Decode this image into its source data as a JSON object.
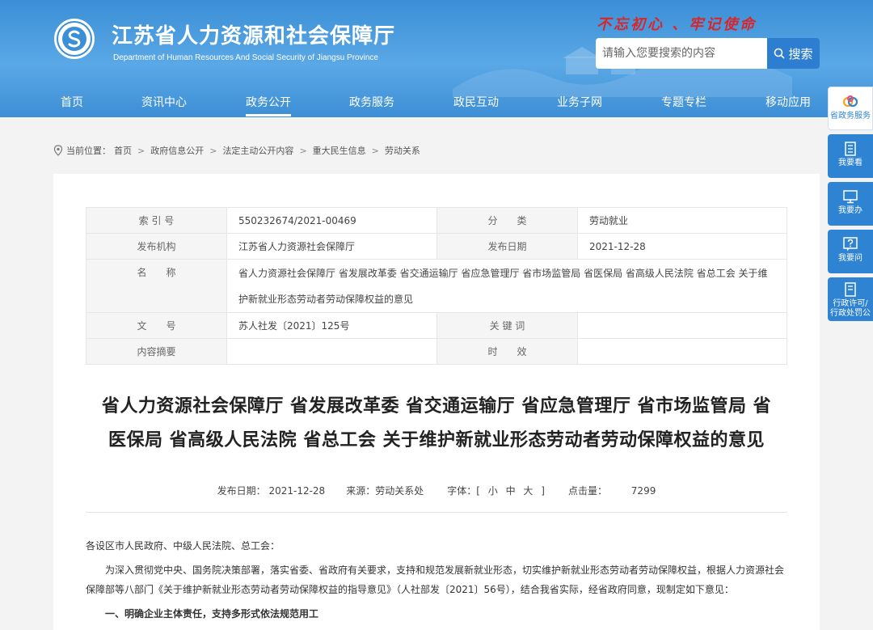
{
  "header": {
    "site_title": "江苏省人力资源和社会保障厅",
    "site_subtitle": "Department of Human Resources And Social Security of Jiangsu Province",
    "slogan": "不忘初心 、牢记使命",
    "search_placeholder": "请输入您要搜索的内容",
    "search_button": "搜索"
  },
  "nav": [
    "首页",
    "资讯中心",
    "政务公开",
    "政务服务",
    "政民互动",
    "业务子网",
    "专题专栏",
    "移动应用"
  ],
  "sidebar": [
    {
      "label": "省政务服务",
      "icon": "service-logo-icon"
    },
    {
      "label": "我要看",
      "icon": "document-icon"
    },
    {
      "label": "我要办",
      "icon": "monitor-icon"
    },
    {
      "label": "我要问",
      "icon": "question-icon"
    },
    {
      "label1": "行政许可/",
      "label2": "行政处罚公",
      "icon": "list-icon"
    }
  ],
  "breadcrumb": {
    "prefix": "当前位置：",
    "items": [
      "首页",
      "政府信息公开",
      "法定主动公开内容",
      "重大民生信息",
      "劳动关系"
    ]
  },
  "meta": {
    "index_label": "索 引 号",
    "index_value": "550232674/2021-00469",
    "category_label": "分　　类",
    "category_value": "劳动就业",
    "publisher_label": "发布机构",
    "publisher_value": "江苏省人力资源社会保障厅",
    "date_label": "发布日期",
    "date_value": "2021-12-28",
    "name_label": "名　　称",
    "name_value": "省人力资源社会保障厅 省发展改革委 省交通运输厅 省应急管理厅 省市场监管局 省医保局 省高级人民法院 省总工会 关于维护新就业形态劳动者劳动保障权益的意见",
    "docno_label": "文　　号",
    "docno_value": "苏人社发〔2021〕125号",
    "keywords_label": "关 键 词",
    "keywords_value": "",
    "abstract_label": "内容摘要",
    "abstract_value": "",
    "validity_label": "时　　效",
    "validity_value": ""
  },
  "document": {
    "title_line1": "省人力资源社会保障厅 省发展改革委 省交通运输厅 省应急管理厅 省市场监管局 省",
    "title_line2": "医保局 省高级人民法院 省总工会 关于维护新就业形态劳动者劳动保障权益的意见",
    "info_date": "发布日期： 2021-12-28",
    "info_source": "来源：劳动关系处",
    "font_label": "字体：[",
    "font_small": "小",
    "font_medium": "中",
    "font_large": "大",
    "font_end": "]",
    "clicks_label": "点击量：",
    "clicks_value": "7299",
    "salutation": "各设区市人民政府、中级人民法院、总工会：",
    "para1": "为深入贯彻党中央、国务院决策部署，落实省委、省政府有关要求，支持和规范发展新就业形态，切实维护新就业形态劳动者劳动保障权益，根据人力资源社会保障部等八部门《关于维护新就业形态劳动者劳动保障权益的指导意见》（人社部发〔2021〕56号），结合我省实际，经省政府同意，现制定如下意见：",
    "heading1": "一、明确企业主体责任，支持多形式依法规范用工"
  }
}
